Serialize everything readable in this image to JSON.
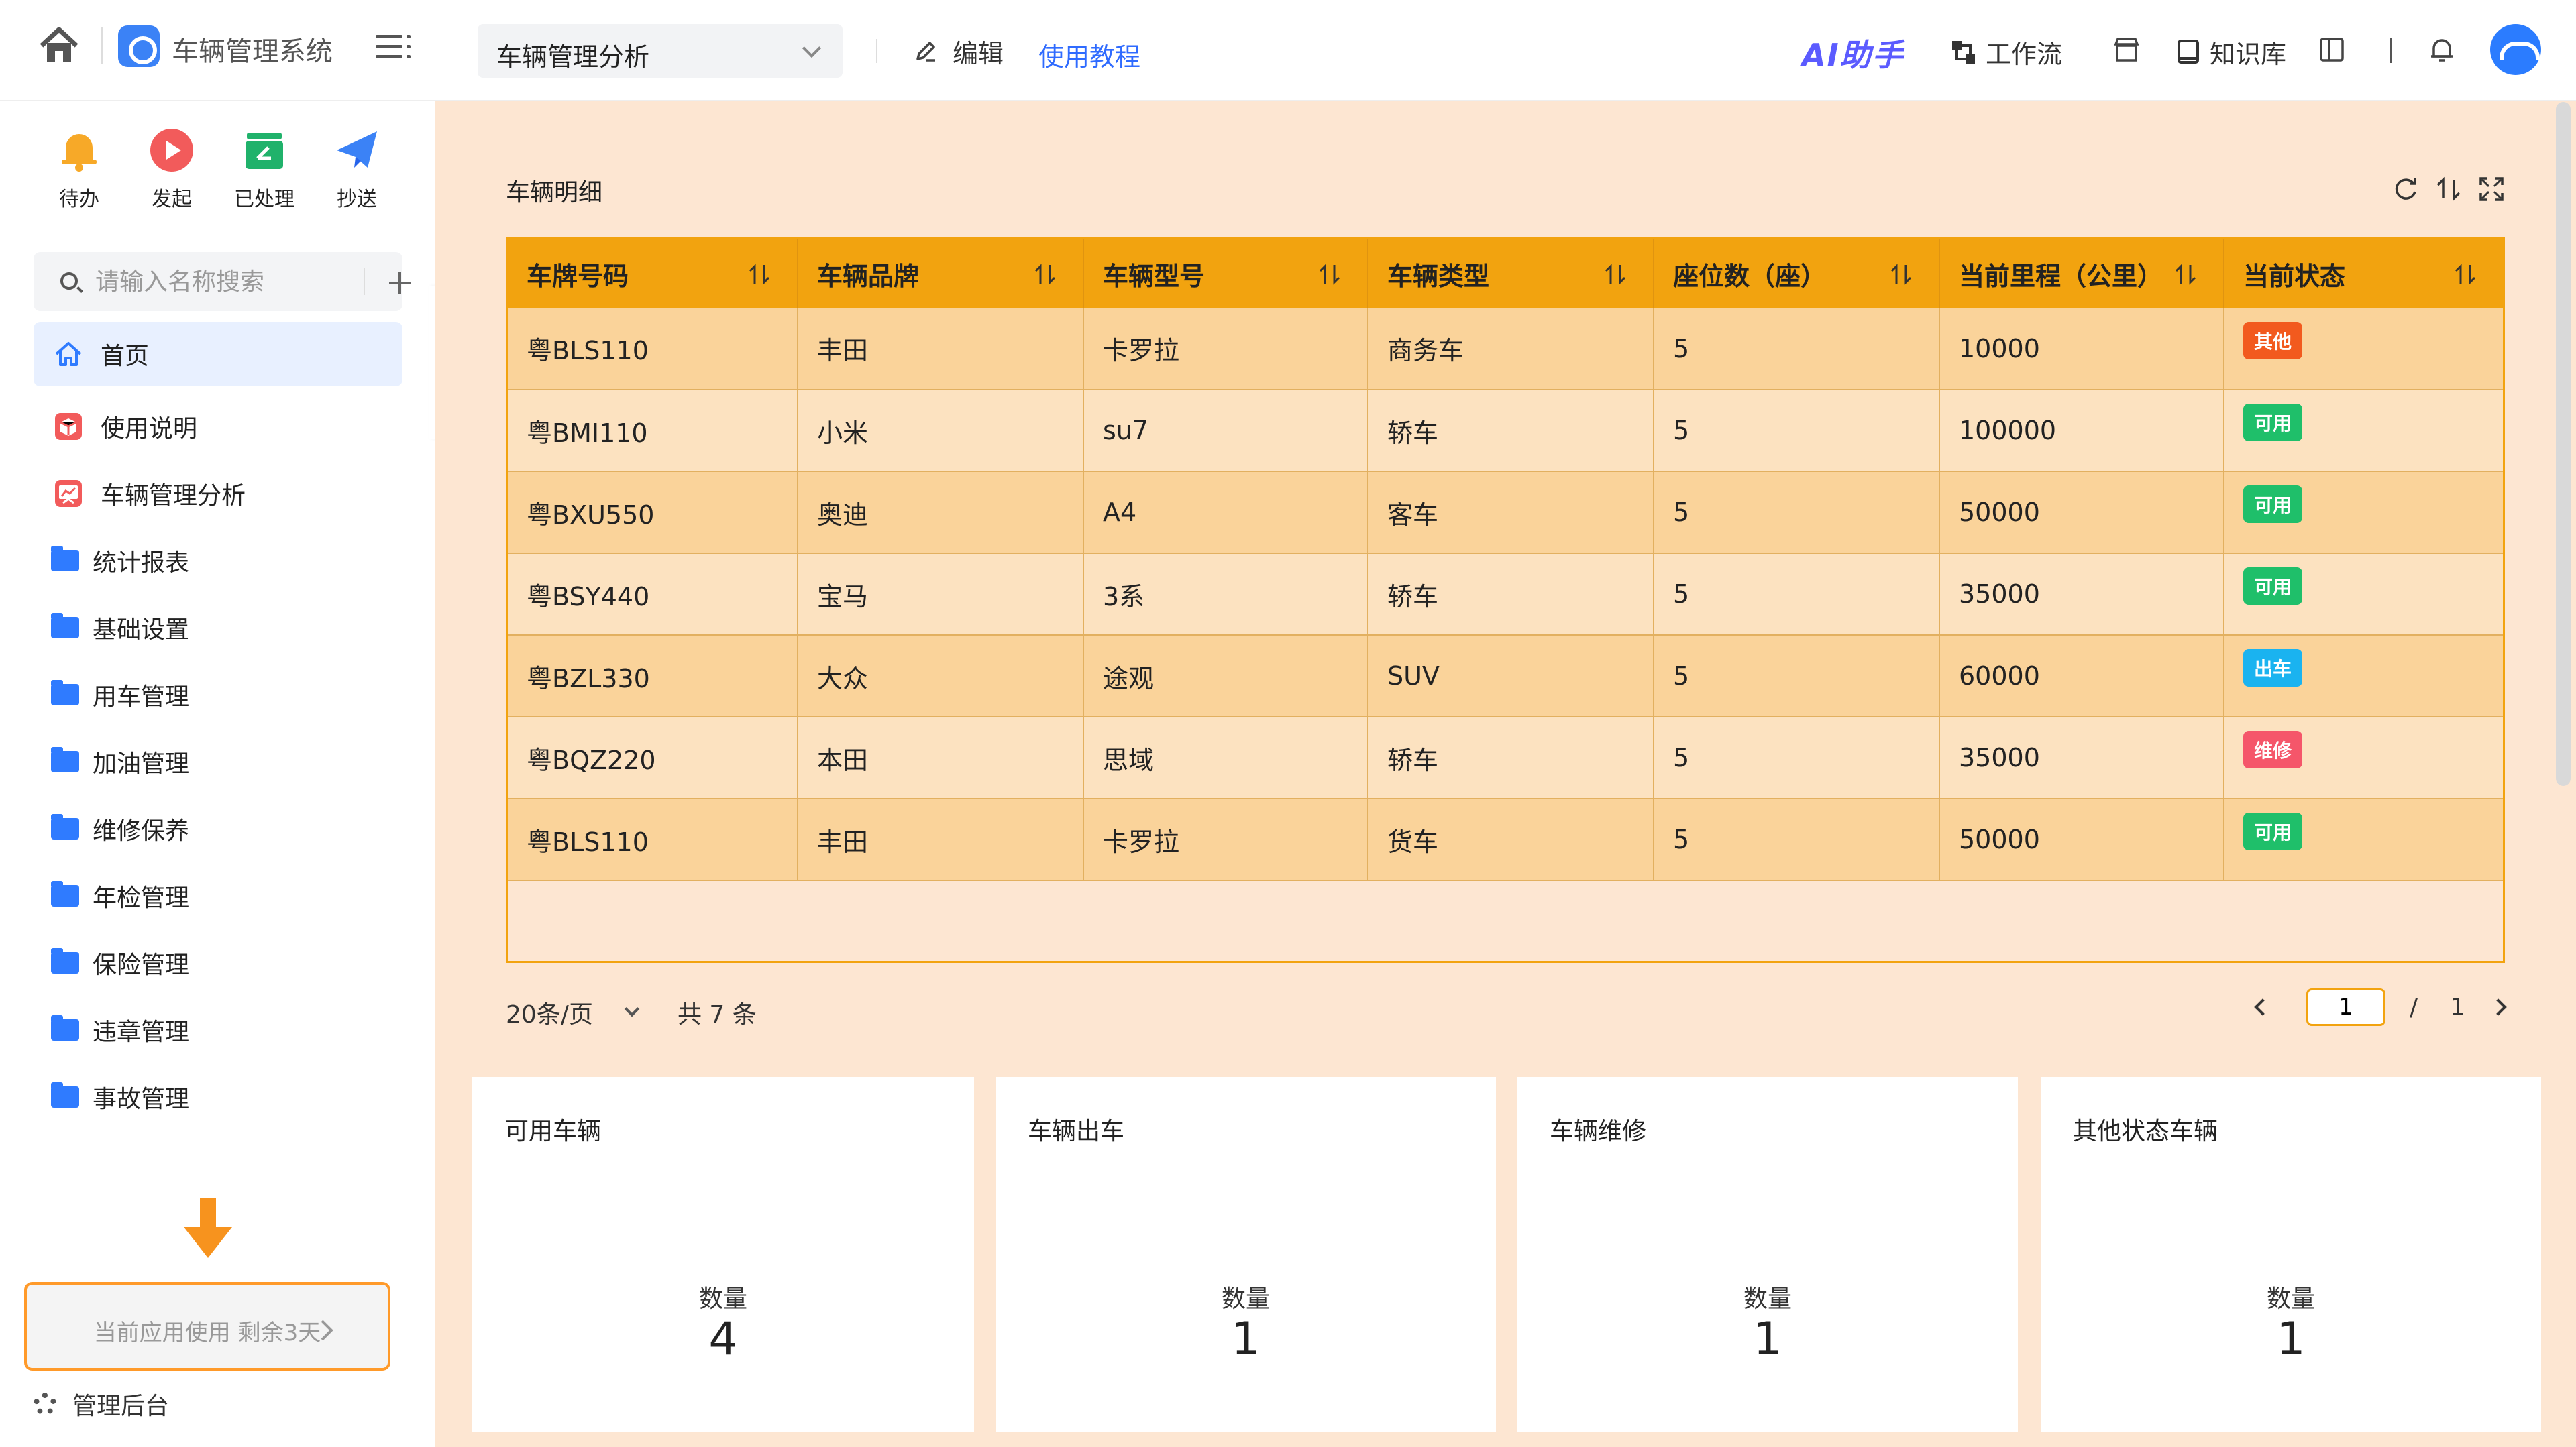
{
  "header": {
    "app_name": "车辆管理系统",
    "page_select": "车辆管理分析",
    "edit_label": "编辑",
    "tutorial_label": "使用教程",
    "ai_label": "AI助手",
    "workflow_label": "工作流",
    "knowledge_label": "知识库"
  },
  "sidebar": {
    "quick_actions": [
      {
        "label": "待办",
        "icon": "bell-icon",
        "color": "#f7a928"
      },
      {
        "label": "发起",
        "icon": "play-icon",
        "color": "#f25b5b"
      },
      {
        "label": "已处理",
        "icon": "done-icon",
        "color": "#20b26b"
      },
      {
        "label": "抄送",
        "icon": "paper-plane-icon",
        "color": "#3b82f6"
      }
    ],
    "search_placeholder": "请输入名称搜索",
    "items": [
      {
        "label": "首页",
        "icon": "home-icon"
      },
      {
        "label": "使用说明",
        "icon": "doc-icon"
      },
      {
        "label": "车辆管理分析",
        "icon": "chart-icon"
      },
      {
        "label": "统计报表",
        "icon": "folder-icon"
      },
      {
        "label": "基础设置",
        "icon": "folder-icon"
      },
      {
        "label": "用车管理",
        "icon": "folder-icon"
      },
      {
        "label": "加油管理",
        "icon": "folder-icon"
      },
      {
        "label": "维修保养",
        "icon": "folder-icon"
      },
      {
        "label": "年检管理",
        "icon": "folder-icon"
      },
      {
        "label": "保险管理",
        "icon": "folder-icon"
      },
      {
        "label": "违章管理",
        "icon": "folder-icon"
      },
      {
        "label": "事故管理",
        "icon": "folder-icon"
      }
    ],
    "trial_text": "当前应用使用 剩余3天",
    "admin_label": "管理后台"
  },
  "panel": {
    "title": "车辆明细",
    "columns": [
      "车牌号码",
      "车辆品牌",
      "车辆型号",
      "车辆类型",
      "座位数（座）",
      "当前里程（公里）",
      "当前状态"
    ],
    "rows": [
      {
        "plate": "粤BLS110",
        "brand": "丰田",
        "model": "卡罗拉",
        "type": "商务车",
        "seats": "5",
        "mileage": "10000",
        "status": "其他",
        "status_color": "#f25a1e"
      },
      {
        "plate": "粤BMI110",
        "brand": "小米",
        "model": "su7",
        "type": "轿车",
        "seats": "5",
        "mileage": "100000",
        "status": "可用",
        "status_color": "#1fbf6a"
      },
      {
        "plate": "粤BXU550",
        "brand": "奥迪",
        "model": "A4",
        "type": "客车",
        "seats": "5",
        "mileage": "50000",
        "status": "可用",
        "status_color": "#1fbf6a"
      },
      {
        "plate": "粤BSY440",
        "brand": "宝马",
        "model": "3系",
        "type": "轿车",
        "seats": "5",
        "mileage": "35000",
        "status": "可用",
        "status_color": "#1fbf6a"
      },
      {
        "plate": "粤BZL330",
        "brand": "大众",
        "model": "途观",
        "type": "SUV",
        "seats": "5",
        "mileage": "60000",
        "status": "出车",
        "status_color": "#1ab3f0"
      },
      {
        "plate": "粤BQZ220",
        "brand": "本田",
        "model": "思域",
        "type": "轿车",
        "seats": "5",
        "mileage": "35000",
        "status": "维修",
        "status_color": "#f5566a"
      },
      {
        "plate": "粤BLS110",
        "brand": "丰田",
        "model": "卡罗拉",
        "type": "货车",
        "seats": "5",
        "mileage": "50000",
        "status": "可用",
        "status_color": "#1fbf6a"
      }
    ],
    "page_size": "20条/页",
    "total": "共 7 条",
    "current_page": "1",
    "page_sep": "/",
    "total_pages": "1"
  },
  "cards": [
    {
      "title": "可用车辆",
      "label": "数量",
      "value": "4"
    },
    {
      "title": "车辆出车",
      "label": "数量",
      "value": "1"
    },
    {
      "title": "车辆维修",
      "label": "数量",
      "value": "1"
    },
    {
      "title": "其他状态车辆",
      "label": "数量",
      "value": "1"
    }
  ],
  "colors": {
    "accent": "#f2a30f",
    "main_bg": "#fde6d2",
    "link": "#2f6bff"
  }
}
